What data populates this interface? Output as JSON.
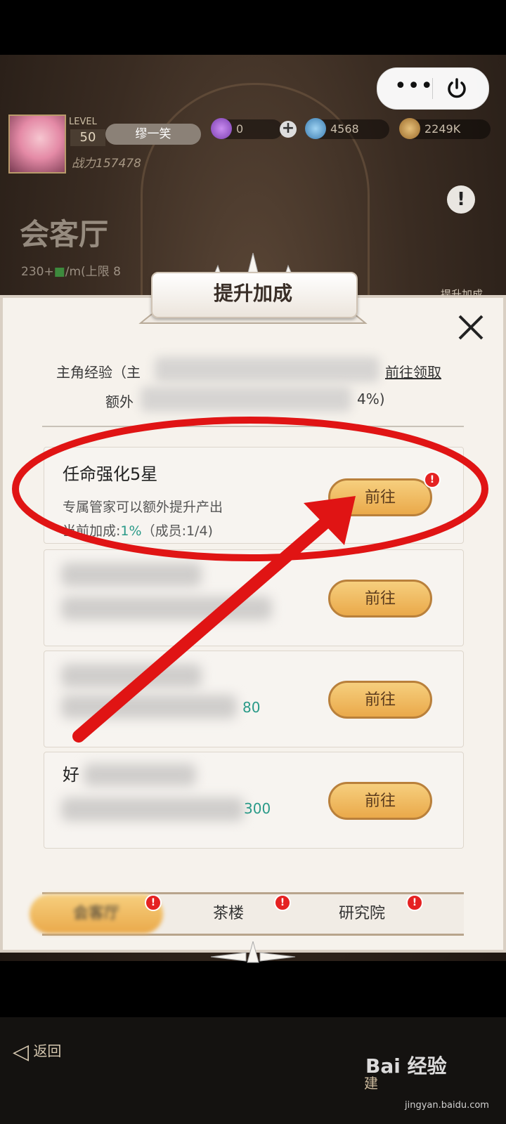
{
  "hud": {
    "level_label": "LEVEL",
    "level": "50",
    "player_name": "缪一笑",
    "combat_power": "战力157478",
    "gems": "0",
    "crystals": "4568",
    "gold": "2249K"
  },
  "room": {
    "title": "会客厅",
    "rate_prefix": "230+",
    "rate_suffix": "/m(上限 8",
    "side_button": "提升加成"
  },
  "modal": {
    "title": "提升加成",
    "exp_prefix": "主角经验（主",
    "exp_link": "前往领取",
    "extra_prefix": "额外",
    "extra_suffix": "4%)",
    "cards": [
      {
        "title": "任命强化5星",
        "desc": "专属管家可以额外提升产出",
        "rate_label": "当前加成:",
        "rate_pct": "1%",
        "rate_tail": "（成员:1/4)",
        "button": "前往"
      },
      {
        "button": "前往"
      },
      {
        "tail": "80",
        "button": "前往"
      },
      {
        "title_first": "好",
        "tail": "300",
        "button": "前往"
      }
    ],
    "tabs": [
      "会客厅",
      "茶楼",
      "研究院"
    ]
  },
  "bottom": {
    "back_label": "返回",
    "build_label": "建"
  },
  "watermark": {
    "brand": "Bai 经验",
    "url": "jingyan.baidu.com"
  },
  "colors": {
    "accent_button": "#eaa94a",
    "annotation_red": "#e01414",
    "rate_green": "#2a9a88"
  }
}
